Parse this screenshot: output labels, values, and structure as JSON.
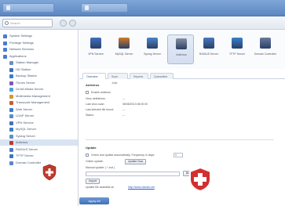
{
  "titlebar": {
    "window_title": "",
    "panel_label": "Control Panel"
  },
  "toolbar": {
    "search_placeholder": "Search"
  },
  "sidebar": {
    "items": [
      {
        "label": "System Settings",
        "color": "#4a7bd0",
        "indent": 0
      },
      {
        "label": "Privilege Settings",
        "color": "#4a7bd0",
        "indent": 0
      },
      {
        "label": "Network Services",
        "color": "#4a7bd0",
        "indent": 0
      },
      {
        "label": "Applications",
        "color": "#4a7bd0",
        "indent": 0
      },
      {
        "label": "Station Manager",
        "color": "#6a8fc8",
        "indent": 1
      },
      {
        "label": "HD Station",
        "color": "#3e6fc0",
        "indent": 1
      },
      {
        "label": "Backup Station",
        "color": "#2f7fd8",
        "indent": 1
      },
      {
        "label": "iTunes Server",
        "color": "#7b5ab8",
        "indent": 1
      },
      {
        "label": "DLNA Media Server",
        "color": "#4aa0d8",
        "indent": 1
      },
      {
        "label": "Multimedia Management",
        "color": "#d09a30",
        "indent": 1
      },
      {
        "label": "Transcode Management",
        "color": "#c85a3a",
        "indent": 1
      },
      {
        "label": "Web Server",
        "color": "#3a7ed0",
        "indent": 1
      },
      {
        "label": "LDAP Server",
        "color": "#5a8ad0",
        "indent": 1
      },
      {
        "label": "VPN Service",
        "color": "#4a6fb8",
        "indent": 1
      },
      {
        "label": "MySQL Server",
        "color": "#3a80c0",
        "indent": 1
      },
      {
        "label": "Syslog Server",
        "color": "#5a90c8",
        "indent": 1
      },
      {
        "label": "Antivirus",
        "color": "#c0392b",
        "indent": 1
      },
      {
        "label": "RADIUS Server",
        "color": "#4a7ac8",
        "indent": 1
      },
      {
        "label": "TFTP Server",
        "color": "#3a78c0",
        "indent": 1
      },
      {
        "label": "Domain Controller",
        "color": "#5a86c8",
        "indent": 1
      }
    ]
  },
  "apps": {
    "tiles": [
      {
        "label": "VPN Service",
        "color": "#3f6fbf"
      },
      {
        "label": "MySQL Server",
        "color": "#d07a2a"
      },
      {
        "label": "Syslog Server",
        "color": "#4a86c8"
      },
      {
        "label": "Antivirus",
        "color": "#8a8fa0"
      },
      {
        "label": "RADIUS Server",
        "color": "#4a78c0"
      },
      {
        "label": "TFTP Server",
        "color": "#3a80c8"
      },
      {
        "label": "Domain Controller",
        "color": "#6a7aa0"
      }
    ]
  },
  "tabs": [
    {
      "label": "Overview",
      "active": true
    },
    {
      "label": "Scan Jobs",
      "active": false
    },
    {
      "label": "Reports",
      "active": false
    },
    {
      "label": "Quarantine",
      "active": false
    }
  ],
  "antivirus": {
    "title": "Antivirus",
    "enable_label": "Enable antivirus",
    "rows": [
      {
        "label": "Virus definitions:",
        "value": "---"
      },
      {
        "label": "Last virus scan:",
        "value": "08/08/2013 08:00:00"
      },
      {
        "label": "Last infected file found:",
        "value": "---"
      },
      {
        "label": "Status:",
        "value": "---"
      }
    ]
  },
  "update": {
    "title": "Update",
    "auto_label": "Check and update automatically. Frequency in days:",
    "auto_value": "1",
    "online_label": "Online update:",
    "online_button": "Update Now",
    "manual_label": "Manual update: ( *.cvd )",
    "browse_button": "Browse...",
    "import_button": "Import",
    "website_label": "Update file available at:",
    "website_link": "http://www.clamav.net"
  },
  "footer": {
    "apply_label": "Apply All"
  },
  "colors": {
    "accent": "#3f6fb8",
    "shield": "#d32f2f"
  }
}
